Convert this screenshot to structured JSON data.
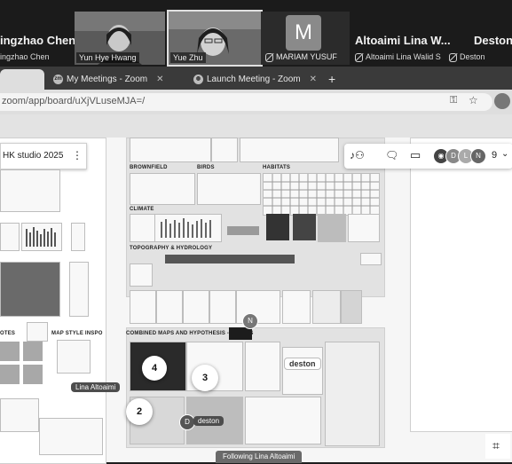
{
  "participants": {
    "left_name_big": "ingzhao Chen",
    "left_name_small": "ingzhao Chen",
    "video1_name": "Yun Hye Hwang",
    "video2_name": "Yue Zhu",
    "avatar_letter": "M",
    "avatar_name": "MARIAM YUSUF",
    "altoaimi_big": "Altoaimi Lina W...",
    "altoaimi_small": "Altoaimi Lina Walid S",
    "deston_big": "Deston",
    "deston_small": "Deston"
  },
  "browser": {
    "tabs": [
      {
        "label": "My Meetings - Zoom",
        "icon": "zm"
      },
      {
        "label": "Launch Meeting - Zoom",
        "icon": "globe"
      }
    ],
    "url": "zoom/app/board/uXjVLuseMJA=/",
    "new_tab_label": "+"
  },
  "board": {
    "left_title": "HK studio 2025",
    "sections": {
      "brownfield": "BROWNFIELD",
      "birds": "BIRDS",
      "habitats": "HABITATS",
      "climate": "CLIMATE",
      "topography": "TOPOGRAPHY & HYDROLOGY",
      "combined": "COMBINED MAPS AND HYPOTHESIS - DRAFTS",
      "notes": "OTES",
      "map_style": "MAP STYLE INSPO"
    },
    "markers": [
      "4",
      "3",
      "2"
    ],
    "cursor_labels": {
      "lina": "Lina Altoaimi",
      "deston": "deston",
      "deston_big": "deston"
    },
    "cursor_avatars": {
      "n": "N",
      "d": "D"
    },
    "following": "Following Lina Altoaimi"
  },
  "toolbar": {
    "avatars": [
      "D",
      "L",
      "N"
    ],
    "count": "9"
  },
  "colors": {
    "strip_bg": "#1b1b1b",
    "board_bg": "#f6f6f6"
  }
}
